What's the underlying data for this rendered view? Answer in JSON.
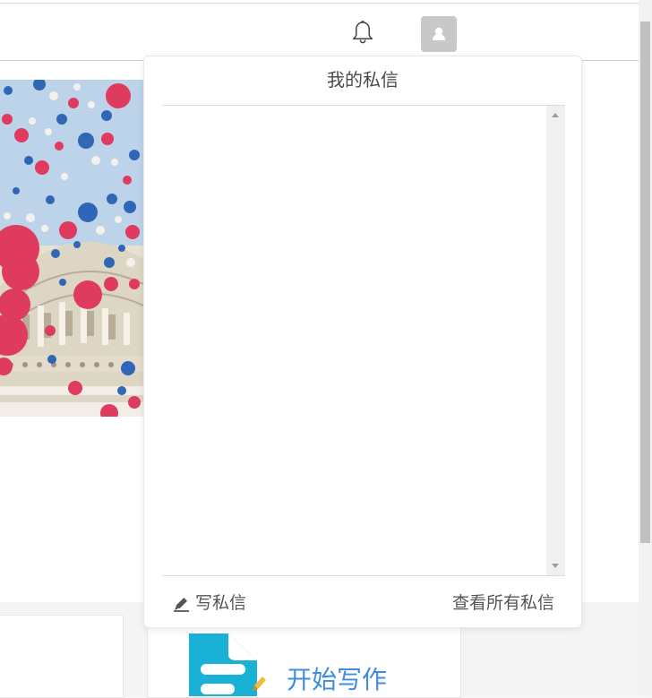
{
  "panel": {
    "title": "我的私信",
    "compose_label": "写私信",
    "view_all_label": "查看所有私信"
  },
  "cards": {
    "write_prompt": "开始写作"
  },
  "icons": {
    "bell": "bell-icon",
    "avatar": "user-icon",
    "pencil": "pencil-icon",
    "document": "document-icon"
  },
  "colors": {
    "accent_blue": "#3e8de0",
    "icon_cyan": "#1ab1d6",
    "icon_orange": "#f4b844"
  }
}
